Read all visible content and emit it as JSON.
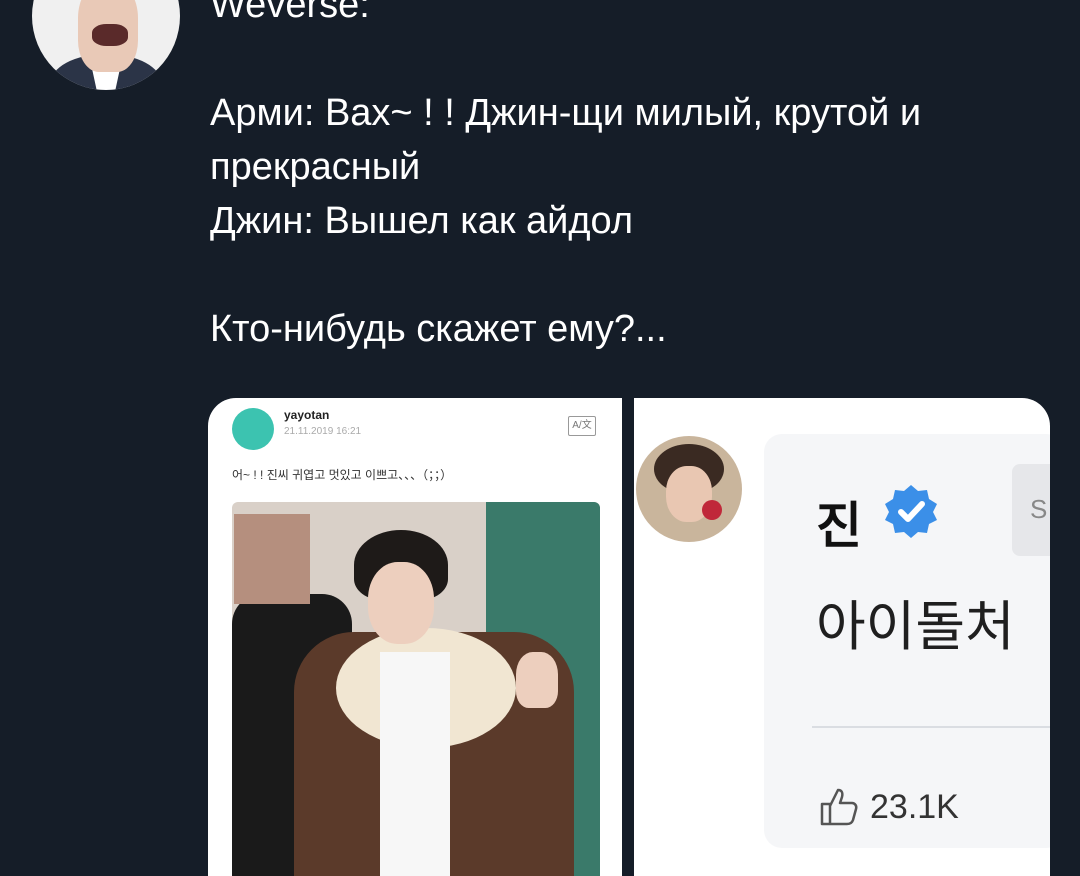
{
  "tweet": {
    "text": "Weverse:\n\nАрми: Вах~ ! ! Джин-щи милый, крутой и прекрасный\nДжин: Вышел как айдол\n\nКто-нибудь скажет ему?..."
  },
  "media": {
    "left_post": {
      "username": "yayotan",
      "date": "21.11.2019 16:21",
      "text": "어~ ! ! 진씨 귀엽고 멋있고 이쁘고、、、（；；）",
      "translate_icon_label": "A/文"
    },
    "right_post": {
      "author": "진",
      "text": "아이돌처",
      "side_button_text": "S",
      "likes": "23.1K",
      "verified_color": "#3b8fe8"
    }
  },
  "icons": {
    "verified": "verified-badge-icon",
    "like": "thumbs-up-icon",
    "translate": "translate-icon"
  }
}
